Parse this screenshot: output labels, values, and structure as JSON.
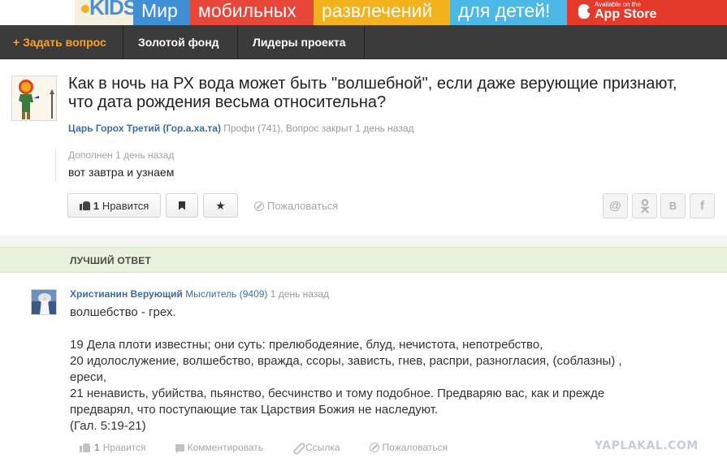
{
  "banner": {
    "logo": "KIDS",
    "words": [
      "Мир",
      "мобильных",
      "развлечений",
      "для детей!"
    ],
    "app_small": "Available on the",
    "app_big": "App Store"
  },
  "nav": {
    "ask": "+ Задать вопрос",
    "gold": "Золотой фонд",
    "leaders": "Лидеры проекта"
  },
  "question": {
    "title": "Как в ночь на РХ вода может быть \"волшебной\", если даже верующие признают, что дата рождения весьма относительна?",
    "author": "Царь Горох Третий (Гор.а.ха.та)",
    "rank": "Профи (741),",
    "status": "Вопрос закрыт 1 день назад",
    "added_label": "Дополнен 1 день назад",
    "added_text": "вот завтра и узнаем",
    "like_count": "1",
    "like_label": "Нравится",
    "report": "Пожаловаться",
    "share": {
      "mail": "@",
      "ok": "ok",
      "vk": "B",
      "fb": "f"
    }
  },
  "best_answer_label": "ЛУЧШИЙ ОТВЕТ",
  "answer": {
    "author": "Христианин Верующий",
    "rank": "Мыслитель (9409)",
    "time": "1 день назад",
    "first_line": "волшебство - грех.",
    "lines": [
      "19 Дела плоти известны; они суть: прелюбодеяние, блуд, нечистота, непотребство,",
      "20 идолослужение, волшебство, вражда, ссоры, зависть, гнев, распри, разногласия, (соблазны) ,",
      "ереси,",
      "21 ненависть, убийства, пьянство, бесчинство и тому подобное. Предваряю вас, как и прежде",
      "предварял, что поступающие так Царствия Божия не наследуют.",
      "(Гал. 5:19-21)"
    ],
    "like_count": "1",
    "like_label": "Нравится",
    "comment": "Комментировать",
    "link": "Ссылка",
    "report": "Пожаловаться"
  },
  "watermark": "YAPLAKAL.COM",
  "colors": {
    "nav_bg": "#3b3b3b",
    "nav_accent": "#f8a32c",
    "link": "#3a6ea5",
    "best_band": "#e7f3dd"
  }
}
